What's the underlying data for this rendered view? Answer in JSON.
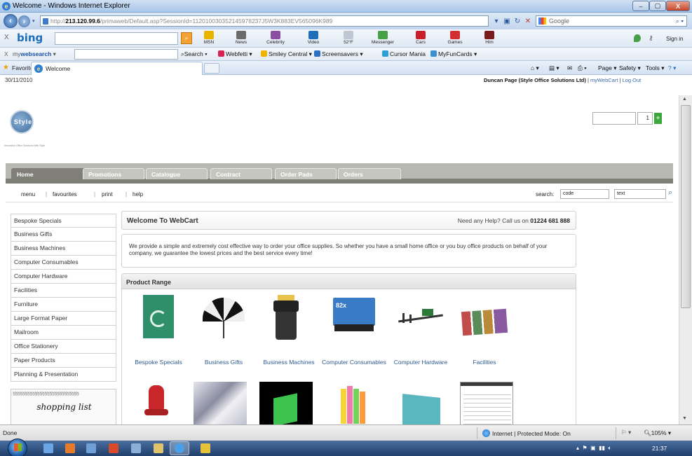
{
  "window": {
    "title": "Welcome - Windows Internet Explorer",
    "min": "–",
    "max": "▢",
    "close": "X"
  },
  "address": {
    "prefix": "http://",
    "host": "213.120.99.6",
    "path": "/primaweb/Default.asp?SessionId=112010030352145978237J5W3K883EV565096K989",
    "search_placeholder": "Google"
  },
  "bing": {
    "logo": "bing",
    "signin": "Sign in",
    "items": [
      {
        "label": "MSN",
        "color": "#e8b400"
      },
      {
        "label": "News",
        "color": "#6b6b6b"
      },
      {
        "label": "Celebrity",
        "color": "#8a4fa0"
      },
      {
        "label": "Video",
        "color": "#1c6fb8"
      },
      {
        "label": "52°F",
        "color": "#bfc7d2"
      },
      {
        "label": "Messenger",
        "color": "#46a045"
      },
      {
        "label": "Cars",
        "color": "#c8202a"
      },
      {
        "label": "Games",
        "color": "#d2312f"
      },
      {
        "label": "Him",
        "color": "#7a1a1a"
      }
    ]
  },
  "mws": {
    "logo_a": "my",
    "logo_b": "websearch",
    "search": "Search",
    "items": [
      {
        "label": "Webfetti",
        "color": "#d4244f"
      },
      {
        "label": "Smiley Central",
        "color": "#f0b400"
      },
      {
        "label": "Screensavers",
        "color": "#2a6fc4"
      },
      {
        "label": "Cursor Mania",
        "color": "#2a9fd8"
      },
      {
        "label": "MyFunCards",
        "color": "#3a8fd0"
      }
    ]
  },
  "favbar": {
    "favorites": "Favorites",
    "tab": "Welcome",
    "page": "Page ▾",
    "safety": "Safety ▾",
    "tools": "Tools ▾"
  },
  "site": {
    "date": "30/11/2010",
    "user": "Duncan Page (Style Office Solutions Ltd)",
    "mywebcart": "myWebCart",
    "logout": "Log Out",
    "logo_text": "Style",
    "logo_caption": "Innovative Office Solutions With Style",
    "cart_qty": "1",
    "cart_add": "+",
    "tabs": [
      "Home",
      "Promotions",
      "Catalogue",
      "Contract",
      "Order Pads",
      "Orders"
    ],
    "subnav": [
      "menu",
      "favourites",
      "print",
      "help"
    ],
    "search_label": "search:",
    "search_code": "code",
    "search_text": "text",
    "sidebar": [
      "Bespoke Specials",
      "Business Gifts",
      "Business Machines",
      "Computer Consumables",
      "Computer Hardware",
      "Facilities",
      "Furniture",
      "Large Format Paper",
      "Mailroom",
      "Office Stationery",
      "Paper Products",
      "Planning & Presentation"
    ],
    "shopping_list": "shopping list",
    "spiral": "§§§§§§§§§§§§§§§§§§§§§§§§§§§",
    "welcome_title": "Welcome To WebCart",
    "help_prefix": "Need any Help? Call us on",
    "help_phone": "01224 681 888",
    "intro": "We provide a simple and extremely cost effective way to order your office supplies. So whether you have a small home office or you buy office products on behalf of your company, we guarantee the lowest prices and the best service every time!",
    "range_title": "Product Range",
    "products": [
      {
        "label": "Bespoke Specials",
        "icon": "recycle-catalogue-image"
      },
      {
        "label": "Business Gifts",
        "icon": "umbrella-image"
      },
      {
        "label": "Business Machines",
        "icon": "shredder-image"
      },
      {
        "label": "Computer Consumables",
        "icon": "toner-cartridge-image"
      },
      {
        "label": "Computer Hardware",
        "icon": "cables-image"
      },
      {
        "label": "Facilities",
        "icon": "swatch-cards-image"
      }
    ]
  },
  "status": {
    "text": "Done",
    "zone": "Internet | Protected Mode: On",
    "zoom": "105%"
  },
  "taskbar": {
    "clock": "21:37"
  }
}
